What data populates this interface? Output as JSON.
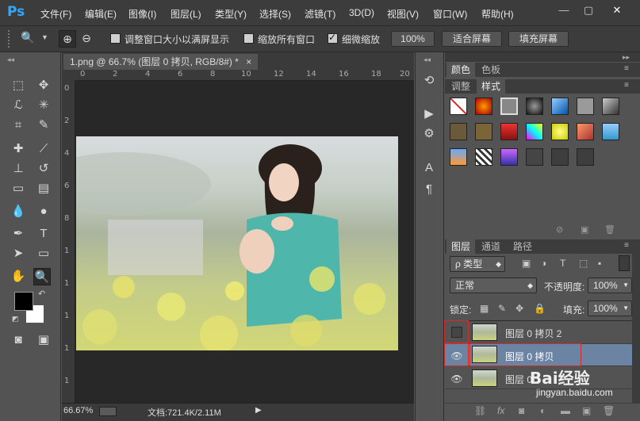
{
  "app": {
    "logo": "Ps"
  },
  "menu": [
    "文件(F)",
    "编辑(E)",
    "图像(I)",
    "图层(L)",
    "类型(Y)",
    "选择(S)",
    "滤镜(T)",
    "3D(D)",
    "视图(V)",
    "窗口(W)",
    "帮助(H)"
  ],
  "window_controls": [
    "—",
    "▢",
    "✕"
  ],
  "options": {
    "zoom_tool": "🔍",
    "resize_label": "调整窗口大小以满屏显示",
    "zoom_all_label": "缩放所有窗口",
    "scrubby_label": "细微缩放",
    "percent_button": "100%",
    "fit_button": "适合屏幕",
    "fill_button": "填充屏幕",
    "resize_checked": false,
    "zoom_all_checked": false,
    "scrubby_checked": true
  },
  "document": {
    "tab_title": "1.png @ 66.7% (图层 0 拷贝, RGB/8#) *",
    "tab_close": "×",
    "ruler_numbers_top": [
      "0",
      "2",
      "4",
      "6",
      "8",
      "10",
      "12",
      "14",
      "16",
      "18",
      "20"
    ],
    "ruler_numbers_left": [
      "0",
      "2",
      "4",
      "6",
      "8",
      "1",
      "1",
      "1",
      "1",
      "1",
      "2"
    ]
  },
  "status": {
    "zoom": "66.67%",
    "doc_info": "文档:721.4K/2.11M"
  },
  "color_panel": {
    "tabs": [
      "颜色",
      "色板"
    ]
  },
  "styles_panel": {
    "tabs": [
      "调整",
      "样式"
    ]
  },
  "layers_panel": {
    "tabs": [
      "图层",
      "通道",
      "路径"
    ],
    "filter_type": "ρ 类型",
    "blend_mode": "正常",
    "opacity_label": "不透明度:",
    "opacity_value": "100%",
    "lock_label": "锁定:",
    "fill_label": "填充:",
    "fill_value": "100%",
    "layers": [
      {
        "name": "图层 0 拷贝 2",
        "visible": false,
        "selected": false
      },
      {
        "name": "图层 0 拷贝",
        "visible": true,
        "selected": true
      },
      {
        "name": "图层 0",
        "visible": true,
        "selected": false
      }
    ]
  },
  "watermark": {
    "text": "Bai经验",
    "url": "jingyan.baidu.com"
  },
  "colors": {
    "ps_blue": "#31a8ff",
    "highlight_red": "#d02c2c",
    "selected_layer": "#6b84a3"
  }
}
